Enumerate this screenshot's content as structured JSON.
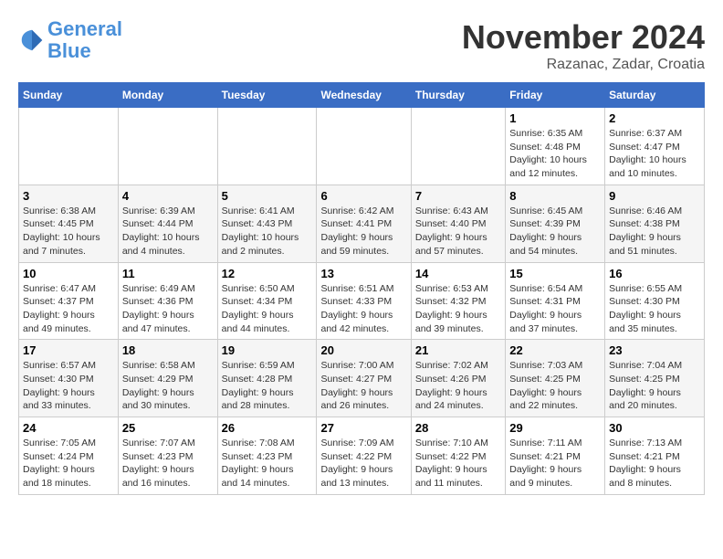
{
  "logo": {
    "line1": "General",
    "line2": "Blue"
  },
  "header": {
    "month": "November 2024",
    "location": "Razanac, Zadar, Croatia"
  },
  "weekdays": [
    "Sunday",
    "Monday",
    "Tuesday",
    "Wednesday",
    "Thursday",
    "Friday",
    "Saturday"
  ],
  "weeks": [
    [
      {
        "day": "",
        "info": ""
      },
      {
        "day": "",
        "info": ""
      },
      {
        "day": "",
        "info": ""
      },
      {
        "day": "",
        "info": ""
      },
      {
        "day": "",
        "info": ""
      },
      {
        "day": "1",
        "info": "Sunrise: 6:35 AM\nSunset: 4:48 PM\nDaylight: 10 hours\nand 12 minutes."
      },
      {
        "day": "2",
        "info": "Sunrise: 6:37 AM\nSunset: 4:47 PM\nDaylight: 10 hours\nand 10 minutes."
      }
    ],
    [
      {
        "day": "3",
        "info": "Sunrise: 6:38 AM\nSunset: 4:45 PM\nDaylight: 10 hours\nand 7 minutes."
      },
      {
        "day": "4",
        "info": "Sunrise: 6:39 AM\nSunset: 4:44 PM\nDaylight: 10 hours\nand 4 minutes."
      },
      {
        "day": "5",
        "info": "Sunrise: 6:41 AM\nSunset: 4:43 PM\nDaylight: 10 hours\nand 2 minutes."
      },
      {
        "day": "6",
        "info": "Sunrise: 6:42 AM\nSunset: 4:41 PM\nDaylight: 9 hours\nand 59 minutes."
      },
      {
        "day": "7",
        "info": "Sunrise: 6:43 AM\nSunset: 4:40 PM\nDaylight: 9 hours\nand 57 minutes."
      },
      {
        "day": "8",
        "info": "Sunrise: 6:45 AM\nSunset: 4:39 PM\nDaylight: 9 hours\nand 54 minutes."
      },
      {
        "day": "9",
        "info": "Sunrise: 6:46 AM\nSunset: 4:38 PM\nDaylight: 9 hours\nand 51 minutes."
      }
    ],
    [
      {
        "day": "10",
        "info": "Sunrise: 6:47 AM\nSunset: 4:37 PM\nDaylight: 9 hours\nand 49 minutes."
      },
      {
        "day": "11",
        "info": "Sunrise: 6:49 AM\nSunset: 4:36 PM\nDaylight: 9 hours\nand 47 minutes."
      },
      {
        "day": "12",
        "info": "Sunrise: 6:50 AM\nSunset: 4:34 PM\nDaylight: 9 hours\nand 44 minutes."
      },
      {
        "day": "13",
        "info": "Sunrise: 6:51 AM\nSunset: 4:33 PM\nDaylight: 9 hours\nand 42 minutes."
      },
      {
        "day": "14",
        "info": "Sunrise: 6:53 AM\nSunset: 4:32 PM\nDaylight: 9 hours\nand 39 minutes."
      },
      {
        "day": "15",
        "info": "Sunrise: 6:54 AM\nSunset: 4:31 PM\nDaylight: 9 hours\nand 37 minutes."
      },
      {
        "day": "16",
        "info": "Sunrise: 6:55 AM\nSunset: 4:30 PM\nDaylight: 9 hours\nand 35 minutes."
      }
    ],
    [
      {
        "day": "17",
        "info": "Sunrise: 6:57 AM\nSunset: 4:30 PM\nDaylight: 9 hours\nand 33 minutes."
      },
      {
        "day": "18",
        "info": "Sunrise: 6:58 AM\nSunset: 4:29 PM\nDaylight: 9 hours\nand 30 minutes."
      },
      {
        "day": "19",
        "info": "Sunrise: 6:59 AM\nSunset: 4:28 PM\nDaylight: 9 hours\nand 28 minutes."
      },
      {
        "day": "20",
        "info": "Sunrise: 7:00 AM\nSunset: 4:27 PM\nDaylight: 9 hours\nand 26 minutes."
      },
      {
        "day": "21",
        "info": "Sunrise: 7:02 AM\nSunset: 4:26 PM\nDaylight: 9 hours\nand 24 minutes."
      },
      {
        "day": "22",
        "info": "Sunrise: 7:03 AM\nSunset: 4:25 PM\nDaylight: 9 hours\nand 22 minutes."
      },
      {
        "day": "23",
        "info": "Sunrise: 7:04 AM\nSunset: 4:25 PM\nDaylight: 9 hours\nand 20 minutes."
      }
    ],
    [
      {
        "day": "24",
        "info": "Sunrise: 7:05 AM\nSunset: 4:24 PM\nDaylight: 9 hours\nand 18 minutes."
      },
      {
        "day": "25",
        "info": "Sunrise: 7:07 AM\nSunset: 4:23 PM\nDaylight: 9 hours\nand 16 minutes."
      },
      {
        "day": "26",
        "info": "Sunrise: 7:08 AM\nSunset: 4:23 PM\nDaylight: 9 hours\nand 14 minutes."
      },
      {
        "day": "27",
        "info": "Sunrise: 7:09 AM\nSunset: 4:22 PM\nDaylight: 9 hours\nand 13 minutes."
      },
      {
        "day": "28",
        "info": "Sunrise: 7:10 AM\nSunset: 4:22 PM\nDaylight: 9 hours\nand 11 minutes."
      },
      {
        "day": "29",
        "info": "Sunrise: 7:11 AM\nSunset: 4:21 PM\nDaylight: 9 hours\nand 9 minutes."
      },
      {
        "day": "30",
        "info": "Sunrise: 7:13 AM\nSunset: 4:21 PM\nDaylight: 9 hours\nand 8 minutes."
      }
    ]
  ]
}
